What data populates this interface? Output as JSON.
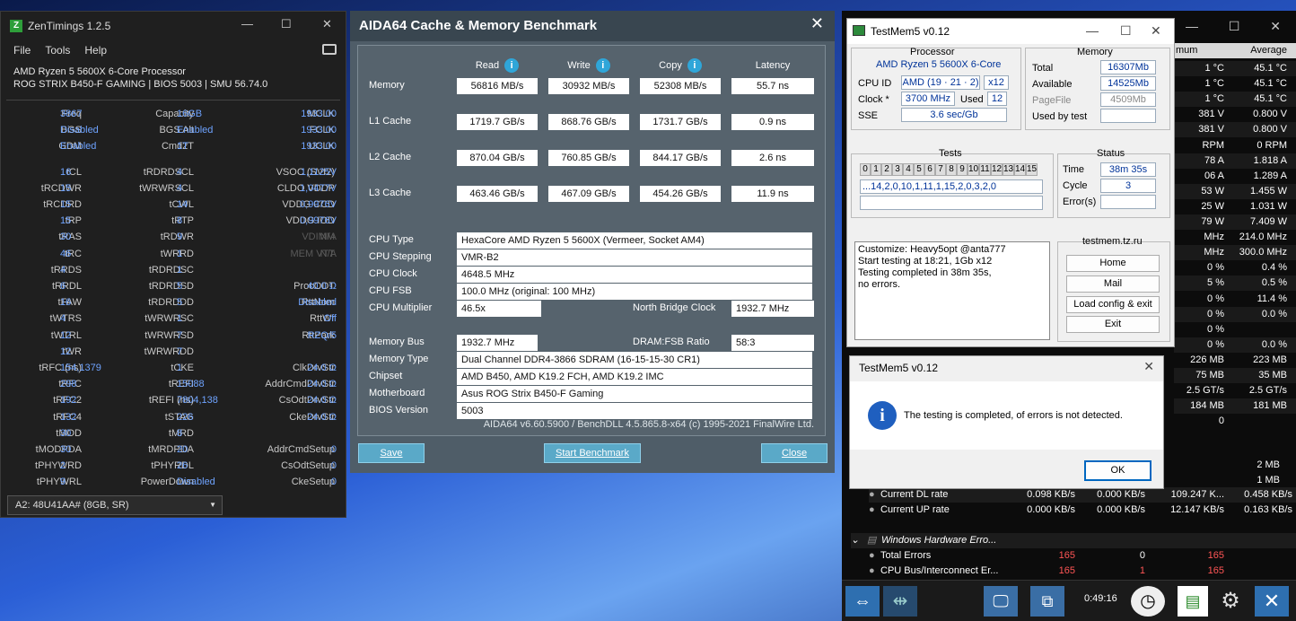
{
  "zen": {
    "title": "ZenTimings 1.2.5",
    "menu": [
      "File",
      "Tools",
      "Help"
    ],
    "cpu": "AMD Ryzen 5 5600X 6-Core Processor",
    "board": "ROG STRIX B450-F GAMING | BIOS 5003 | SMU 56.74.0",
    "rows": [
      [
        [
          "Freq",
          "3867"
        ],
        [
          "Capacity",
          "16GB"
        ],
        [
          "MCLK",
          "1933.00"
        ]
      ],
      [
        [
          "BGS",
          "Disabled"
        ],
        [
          "BGS Alt",
          "Enabled"
        ],
        [
          "FCLK",
          "1933.00"
        ]
      ],
      [
        [
          "GDM",
          "Enabled"
        ],
        [
          "Cmd2T",
          "1T"
        ],
        [
          "UCLK",
          "1933.00"
        ]
      ],
      [
        [
          "tCL",
          "16"
        ],
        [
          "tRDRDSCL",
          "4"
        ],
        [
          "VSOC (SVI2)",
          "1,1125V"
        ]
      ],
      [
        [
          "tRCDWR",
          "15"
        ],
        [
          "tWRWRSCL",
          "4"
        ],
        [
          "CLDO VDDP",
          "1,0477V"
        ]
      ],
      [
        [
          "tRCDRD",
          "15"
        ],
        [
          "tCWL",
          "14"
        ],
        [
          "VDDG CCD",
          "0,9976V"
        ]
      ],
      [
        [
          "tRP",
          "15"
        ],
        [
          "tRTP",
          "8"
        ],
        [
          "VDDG IOD",
          "0,9976V"
        ]
      ],
      [
        [
          "tRAS",
          "30"
        ],
        [
          "tRDWR",
          "9"
        ],
        [
          "VDIMM",
          "N/A"
        ]
      ],
      [
        [
          "tRC",
          "46"
        ],
        [
          "tWRRD",
          "1"
        ],
        [
          "MEM VTT",
          "N/A"
        ]
      ],
      [
        [
          "tRRDS",
          "4"
        ],
        [
          "tRDRDSC",
          "1"
        ],
        [
          "",
          ""
        ]
      ],
      [
        [
          "tRRDL",
          "6"
        ],
        [
          "tRDRDSD",
          "5"
        ],
        [
          "ProcODT",
          "40.0 Ω"
        ]
      ],
      [
        [
          "tFAW",
          "16"
        ],
        [
          "tRDRDDD",
          "5"
        ],
        [
          "RttNom",
          "Disabled"
        ]
      ],
      [
        [
          "tWTRS",
          "4"
        ],
        [
          "tWRWRSC",
          "1"
        ],
        [
          "RttWr",
          "Off"
        ]
      ],
      [
        [
          "tWTRL",
          "12"
        ],
        [
          "tWRWRSD",
          "7"
        ],
        [
          "RttPark",
          "RZQ/5"
        ]
      ],
      [
        [
          "tWR",
          "12"
        ],
        [
          "tWRWRDD",
          "7"
        ],
        [
          "",
          ""
        ]
      ],
      [
        [
          "tRFC (ns)",
          "154,1379"
        ],
        [
          "tCKE",
          "1"
        ],
        [
          "ClkDrvStr",
          "24.0 Ω"
        ]
      ],
      [
        [
          "tRFC",
          "298"
        ],
        [
          "tREFI",
          "15088"
        ],
        [
          "AddrCmdDrvStr",
          "24.0 Ω"
        ]
      ],
      [
        [
          "tRFC2",
          "192"
        ],
        [
          "tREFI (ns)",
          "7804,138"
        ],
        [
          "CsOdtDrvStr",
          "24.0 Ω"
        ]
      ],
      [
        [
          "tRFC4",
          "132"
        ],
        [
          "tSTAG",
          "226"
        ],
        [
          "CkeDrvStr",
          "24.0 Ω"
        ]
      ],
      [
        [
          "tMOD",
          "30"
        ],
        [
          "tMRD",
          "8"
        ],
        [
          "",
          ""
        ]
      ],
      [
        [
          "tMODPDA",
          "30"
        ],
        [
          "tMRDPDA",
          "20"
        ],
        [
          "AddrCmdSetup",
          "0"
        ]
      ],
      [
        [
          "tPHYWRD",
          "2"
        ],
        [
          "tPHYRDL",
          "26"
        ],
        [
          "CsOdtSetup",
          "0"
        ]
      ],
      [
        [
          "tPHYWRL",
          "9"
        ],
        [
          "PowerDown",
          "Disabled"
        ],
        [
          "CkeSetup",
          "0"
        ]
      ]
    ],
    "module": "A2: 48U41AA# (8GB, SR)"
  },
  "aida": {
    "title": "AIDA64 Cache & Memory Benchmark",
    "headers": [
      "Read",
      "Write",
      "Copy",
      "Latency"
    ],
    "bench": [
      [
        "Memory",
        "56816 MB/s",
        "30932 MB/s",
        "52308 MB/s",
        "55.7 ns"
      ],
      [
        "L1 Cache",
        "1719.7 GB/s",
        "868.76 GB/s",
        "1731.7 GB/s",
        "0.9 ns"
      ],
      [
        "L2 Cache",
        "870.04 GB/s",
        "760.85 GB/s",
        "844.17 GB/s",
        "2.6 ns"
      ],
      [
        "L3 Cache",
        "463.46 GB/s",
        "467.09 GB/s",
        "454.26 GB/s",
        "11.9 ns"
      ]
    ],
    "cpu_type": "HexaCore AMD Ryzen 5 5600X  (Vermeer, Socket AM4)",
    "cpu_step": "VMR-B2",
    "cpu_clock": "4648.5 MHz",
    "cpu_fsb": "100.0 MHz  (original: 100 MHz)",
    "cpu_mult": "46.5x",
    "nb_label": "North Bridge Clock",
    "nb": "1932.7 MHz",
    "mem_bus": "1932.7 MHz",
    "dram_label": "DRAM:FSB Ratio",
    "dram": "58:3",
    "mem_type": "Dual Channel DDR4-3866 SDRAM  (16-15-15-30 CR1)",
    "chipset": "AMD B450, AMD K19.2 FCH, AMD K19.2 IMC",
    "mobo": "Asus ROG Strix B450-F Gaming",
    "bios": "5003",
    "labels": {
      "cpu_type": "CPU Type",
      "cpu_step": "CPU Stepping",
      "cpu_clock": "CPU Clock",
      "cpu_fsb": "CPU FSB",
      "cpu_mult": "CPU Multiplier",
      "mem_bus": "Memory Bus",
      "mem_type": "Memory Type",
      "chipset": "Chipset",
      "mobo": "Motherboard",
      "bios": "BIOS Version"
    },
    "footer": "AIDA64 v6.60.5900 / BenchDLL 4.5.865.8-x64  (c) 1995-2021 FinalWire Ltd.",
    "save": "Save",
    "start": "Start Benchmark",
    "close": "Close"
  },
  "tm": {
    "title": "TestMem5 v0.12",
    "processor": "Processor",
    "cpu": "AMD Ryzen 5 5600X 6-Core",
    "cpuid_l": "CPU ID",
    "cpuid": "AMD  (19 · 21 · 2)",
    "threads": "x12",
    "clock_l": "Clock *",
    "clock": "3700 MHz",
    "used_l": "Used",
    "used": "12",
    "sse_l": "SSE",
    "sse": "3.6 sec/Gb",
    "memory": "Memory",
    "total_l": "Total",
    "total": "16307Mb",
    "avail_l": "Available",
    "avail": "14525Mb",
    "page_l": "PageFile",
    "page": "4509Mb",
    "ubt_l": "Used by test",
    "tests": "Tests",
    "testnums": [
      "0",
      "1",
      "2",
      "3",
      "4",
      "5",
      "6",
      "7",
      "8",
      "9",
      "10",
      "11",
      "12",
      "13",
      "14",
      "15"
    ],
    "seq": "...14,2,0,10,1,11,1,15,2,0,3,2,0",
    "status": "Status",
    "time_l": "Time",
    "time": "38m 35s",
    "cycle_l": "Cycle",
    "cycle": "3",
    "err_l": "Error(s)",
    "log": [
      "Customize: Heavy5opt @anta777",
      "Start testing at 18:21, 1Gb x12",
      "Testing completed in 38m 35s,",
      "no errors."
    ],
    "site": "testmem.tz.ru",
    "buttons": [
      "Home",
      "Mail",
      "Load config & exit",
      "Exit"
    ]
  },
  "dlg": {
    "title": "TestMem5 v0.12",
    "msg": "The testing is completed, of errors is not detected.",
    "ok": "OK"
  },
  "hw": {
    "hdr": [
      "mum",
      "Average"
    ],
    "rows": [
      [
        "1 °C",
        "45.1 °C"
      ],
      [
        "1 °C",
        "45.1 °C"
      ],
      [
        "1 °C",
        "45.1 °C"
      ],
      [
        "381 V",
        "0.800 V"
      ],
      [
        "381 V",
        "0.800 V"
      ],
      [
        "RPM",
        "0 RPM"
      ],
      [
        "78 A",
        "1.818 A"
      ],
      [
        "06 A",
        "1.289 A"
      ],
      [
        "53 W",
        "1.455 W"
      ],
      [
        "25 W",
        "1.031 W"
      ],
      [
        "79 W",
        "7.409 W"
      ],
      [
        "MHz",
        "214.0 MHz"
      ],
      [
        "MHz",
        "300.0 MHz"
      ],
      [
        "0 %",
        "0.4 %"
      ],
      [
        "5 %",
        "0.5 %"
      ],
      [
        "0 %",
        "11.4 %"
      ],
      [
        "0 %",
        "0.0 %"
      ],
      [
        "0 %",
        ""
      ],
      [
        "0 %",
        "0.0 %"
      ],
      [
        "226 MB",
        "223 MB"
      ],
      [
        "75 MB",
        "35 MB"
      ],
      [
        "2.5 GT/s",
        "2.5 GT/s"
      ],
      [
        "184 MB",
        "181 MB"
      ],
      [
        "0",
        ""
      ]
    ],
    "mb": [
      "2 MB",
      "1 MB"
    ],
    "dl": [
      "Current DL rate",
      "0.098 KB/s",
      "0.000 KB/s",
      "109.247 K...",
      "0.458 KB/s"
    ],
    "ul": [
      "Current UP rate",
      "0.000 KB/s",
      "0.000 KB/s",
      "12.147 KB/s",
      "0.163 KB/s"
    ],
    "section": "Windows Hardware Erro...",
    "te": [
      "Total Errors",
      "165",
      "0",
      "165"
    ],
    "cpu": [
      "CPU Bus/Interconnect Er...",
      "165",
      "1",
      "165"
    ],
    "clock": "0:49:16"
  }
}
